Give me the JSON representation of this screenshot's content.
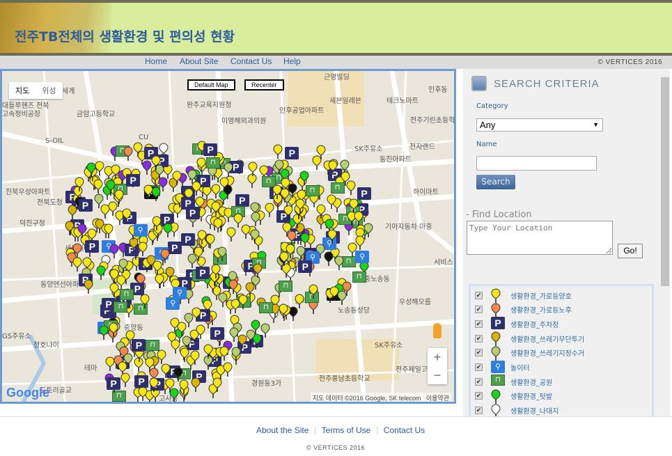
{
  "header": {
    "title": "전주TB전체의 생활환경 및 편의성 현황",
    "copyright": "© VERTICES 2016"
  },
  "nav": [
    {
      "label": "Home"
    },
    {
      "label": "About Site"
    },
    {
      "label": "Contact Us"
    },
    {
      "label": "Help"
    }
  ],
  "map": {
    "type_tabs": [
      "지도",
      "위성"
    ],
    "default_map_label": "Default Map",
    "recenter_label": "Recenter",
    "zoom_in": "+",
    "zoom_out": "−",
    "logo": "Google",
    "attribution": "지도 데이터 ©2016 Google, SK telecom",
    "terms": "이용약관",
    "place_labels": [
      "근영빌딩",
      "인후동",
      "세븐일레븐",
      "테크노마트",
      "완주교육지원청",
      "인후공업아파트",
      "전주기린초등학교",
      "금암고등학교",
      "이영해외과의원",
      "S-OIL",
      "SK주유소",
      "전자랜드",
      "동진아파트",
      "하이마트",
      "대들루핸즈 전북",
      "고속정비공장",
      "진북우성아파트",
      "전북도청",
      "덕진구청",
      "기아자동차 아중",
      "세븐일레븐",
      "서비스",
      "노송동성당",
      "중노송동",
      "동양엔선아파트",
      "우성해오름",
      "중앙동",
      "GS주유소",
      "청호나이",
      "SK주유소",
      "전주제일고",
      "경원동3가",
      "전주풍남초등학교",
      "도토리골교",
      "고사동",
      "중학교",
      "CU",
      "테마",
      "세계"
    ]
  },
  "search": {
    "heading": "SEARCH CRITERIA",
    "category_label": "Category",
    "category_value": "Any",
    "name_label": "Name",
    "name_value": "",
    "search_button": "Search",
    "find_location_heading": "- Find Location",
    "location_placeholder": "Type Your Location",
    "go_button": "Go!"
  },
  "legend": [
    {
      "label": "생활환경_가로등양호",
      "icon": "pin",
      "color": "#f5e614",
      "checked": true
    },
    {
      "label": "생활환경_가로등노후",
      "icon": "pin",
      "color": "#f58a4a",
      "checked": true
    },
    {
      "label": "생활환경_주차장",
      "icon": "parking",
      "color": "#2f2f6e",
      "checked": true
    },
    {
      "label": "생활환경_쓰레기무단투기",
      "icon": "pin",
      "color": "#d9b400",
      "checked": true
    },
    {
      "label": "생활환경_쓰레기지정수거",
      "icon": "pin",
      "color": "#b7cf6e",
      "checked": true
    },
    {
      "label": "놀이터",
      "icon": "playground",
      "color": "#2f7de0",
      "checked": true
    },
    {
      "label": "생활환경_공원",
      "icon": "park",
      "color": "#4ea04e",
      "checked": true
    },
    {
      "label": "생활환경_텃밭",
      "icon": "pin",
      "color": "#19d619",
      "checked": true
    },
    {
      "label": "생활환경_나대지",
      "icon": "pin",
      "color": "#ffffff",
      "checked": true
    }
  ],
  "footer": {
    "links": [
      "About the Site",
      "Terms of Use",
      "Contact Us"
    ],
    "copyright": "© VERTICES 2016"
  }
}
